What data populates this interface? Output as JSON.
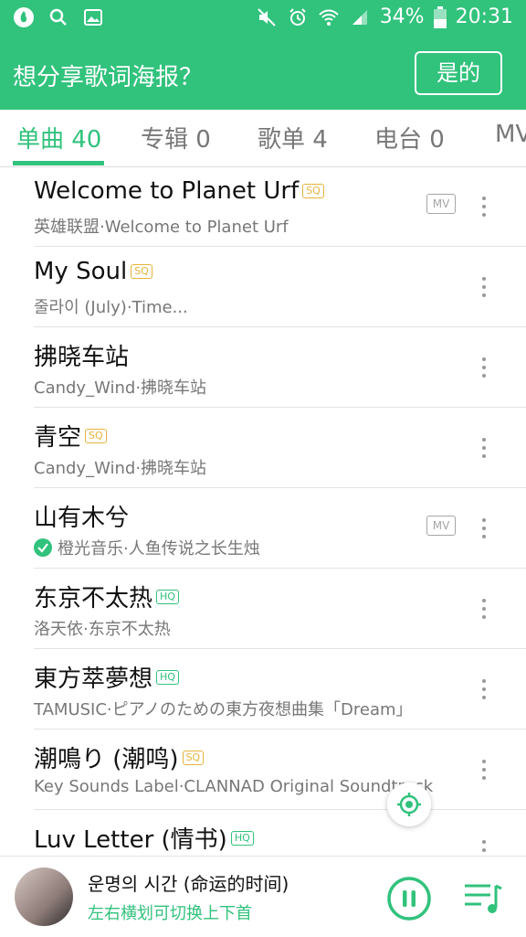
{
  "status_bar": {
    "battery": "34%",
    "time": "20:31"
  },
  "header": {
    "title": "想分享歌词海报？",
    "confirm_button": "是的"
  },
  "tabs": [
    {
      "label": "单曲 40",
      "active": true
    },
    {
      "label": "专辑 0",
      "active": false
    },
    {
      "label": "歌单 4",
      "active": false
    },
    {
      "label": "电台 0",
      "active": false
    },
    {
      "label": "MV",
      "active": false
    }
  ],
  "songs": [
    {
      "title": "Welcome to Planet Urf",
      "badge": "SQ",
      "subtitle": "英雄联盟·Welcome to Planet Urf",
      "mv": "MV"
    },
    {
      "title": "My Soul",
      "badge": "SQ",
      "subtitle": "줄라이 (July)·Time...",
      "mv": ""
    },
    {
      "title": "拂晓车站",
      "badge": "",
      "subtitle": "Candy_Wind·拂晓车站",
      "mv": ""
    },
    {
      "title": "青空",
      "badge": "SQ",
      "subtitle": "Candy_Wind·拂晓车站",
      "mv": ""
    },
    {
      "title": "山有木兮",
      "badge": "",
      "subtitle": "橙光音乐·人鱼传说之长生烛",
      "mv": "MV",
      "downloaded": true
    },
    {
      "title": "东京不太热",
      "badge": "HQ",
      "subtitle": "洛天依·东京不太热",
      "mv": ""
    },
    {
      "title": "東方萃夢想",
      "badge": "HQ",
      "subtitle": "TAMUSIC·ピアノのための東方夜想曲集「Dream」",
      "mv": ""
    },
    {
      "title": "潮鳴り (潮鸣)",
      "badge": "SQ",
      "subtitle": "Key Sounds Label·CLANNAD Original Soundtrack",
      "mv": ""
    },
    {
      "title": "Luv Letter (情书)",
      "badge": "HQ",
      "subtitle": "",
      "mv": ""
    }
  ],
  "now_playing": {
    "title": "운명의 시간 (命运的时间)",
    "hint": "左右横划可切换上下首"
  },
  "colors": {
    "accent": "#31c27c",
    "sq": "#e5b33c"
  }
}
